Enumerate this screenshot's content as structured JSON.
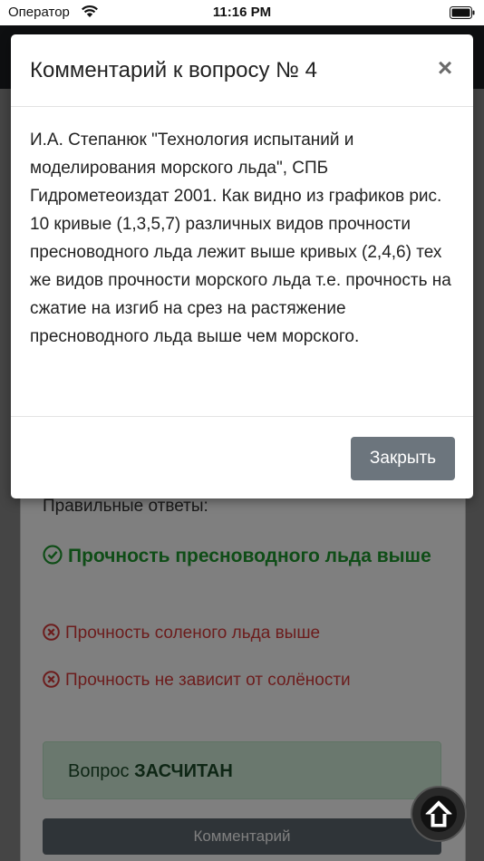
{
  "status_bar": {
    "carrier": "Оператор",
    "time": "11:16 PM"
  },
  "page": {
    "correct_answers_title": "Правильные ответы:",
    "answers": [
      {
        "text": "Прочность пресноводного льда выше",
        "status": "correct"
      },
      {
        "text": "Прочность соленого льда выше",
        "status": "wrong"
      },
      {
        "text": "Прочность не зависит от солёности",
        "status": "wrong"
      }
    ],
    "verdict_prefix": "Вопрос",
    "verdict_status": "ЗАСЧИТАН",
    "comment_button": "Комментарий"
  },
  "modal": {
    "title": "Комментарий к вопросу № 4",
    "close_symbol": "×",
    "body": "И.А. Степанюк \"Технология испытаний и моделирования морского льда\", СПБ Гидрометеоиздат 2001. Как видно из графиков рис. 10 кривые (1,3,5,7) различных видов прочности пресноводного льда лежит выше кривых (2,4,6) тех же видов прочности морского льда т.е. прочность на сжатие на изгиб на срез на растяжение пресноводного льда выше чем морского.",
    "close_button": "Закрыть"
  },
  "colors": {
    "correct": "#1f9a2f",
    "wrong": "#d93a3a",
    "verdict_bg": "#d4f0dc",
    "secondary_button": "#6c757d"
  },
  "icons": {
    "wifi": "wifi-icon",
    "battery": "battery-icon",
    "correct": "check-circle-icon",
    "wrong": "x-circle-icon",
    "scroll_top": "arrow-up-circle-icon"
  }
}
